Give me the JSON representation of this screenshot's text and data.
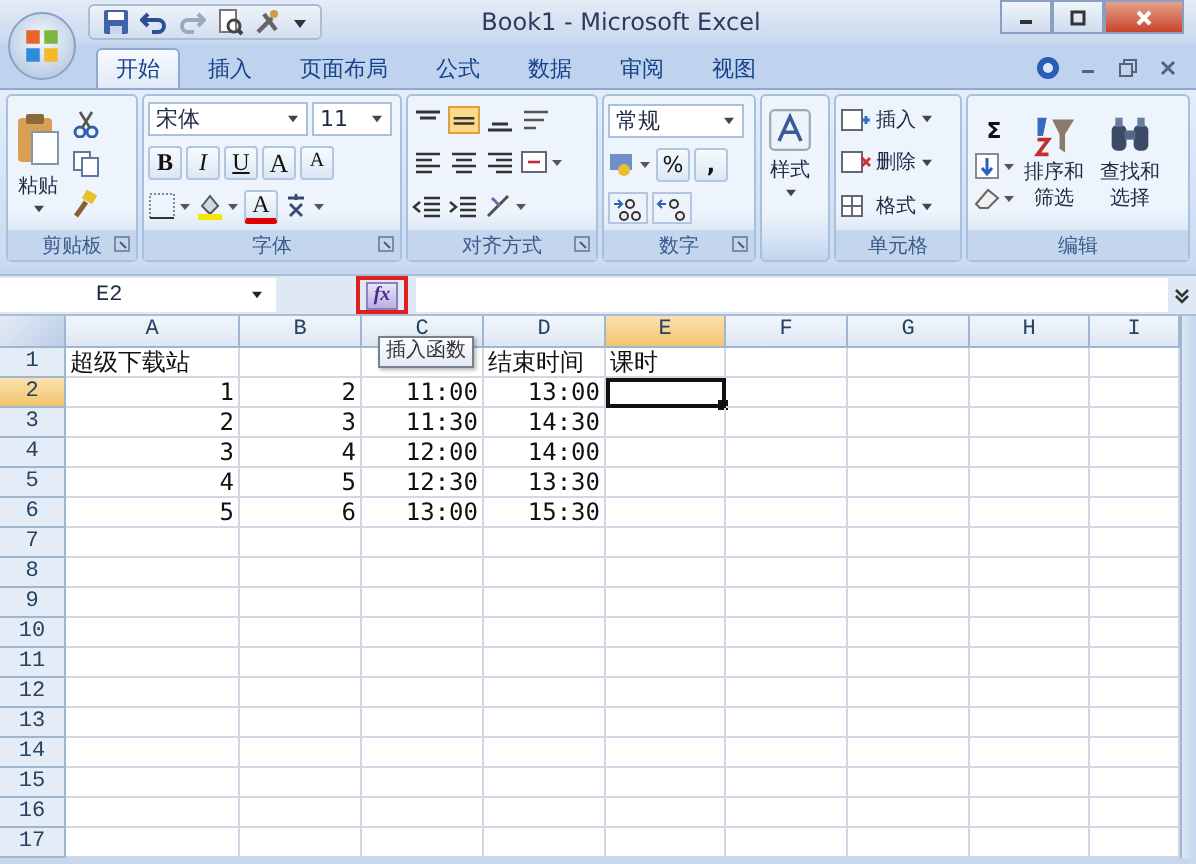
{
  "window": {
    "title": "Book1 - Microsoft Excel"
  },
  "tabs": [
    {
      "label": "开始",
      "selected": true
    },
    {
      "label": "插入",
      "selected": false
    },
    {
      "label": "页面布局",
      "selected": false
    },
    {
      "label": "公式",
      "selected": false
    },
    {
      "label": "数据",
      "selected": false
    },
    {
      "label": "审阅",
      "selected": false
    },
    {
      "label": "视图",
      "selected": false
    }
  ],
  "ribbon": {
    "clipboard": {
      "label": "剪贴板",
      "paste": "粘贴"
    },
    "font": {
      "label": "字体",
      "font_name": "宋体",
      "font_size": "11",
      "buttons": [
        {
          "label": "B",
          "kind": "bold"
        },
        {
          "label": "I",
          "kind": "italic"
        },
        {
          "label": "U",
          "kind": "underline"
        },
        {
          "label": "A",
          "kind": "grow"
        },
        {
          "label": "A",
          "kind": "shrink"
        }
      ],
      "font_color": "A"
    },
    "alignment": {
      "label": "对齐方式"
    },
    "number": {
      "label": "数字",
      "format": "常规",
      "percent": "%",
      "comma": ","
    },
    "styles": {
      "label": "样式"
    },
    "cells": {
      "label": "单元格",
      "items": [
        {
          "label": "插入",
          "kind": "insert"
        },
        {
          "label": "删除",
          "kind": "delete"
        },
        {
          "label": "格式",
          "kind": "format"
        }
      ]
    },
    "editing": {
      "label": "编辑",
      "sum": "Σ",
      "sort": "排序和筛选",
      "find": "查找和选择"
    }
  },
  "formula_bar": {
    "name_box": "E2",
    "fx": {
      "label": "fx",
      "highlighted": true
    }
  },
  "tooltip": "插入函数",
  "sheet": {
    "columns": [
      {
        "label": "A",
        "selected": false
      },
      {
        "label": "B",
        "selected": false
      },
      {
        "label": "C",
        "selected": false
      },
      {
        "label": "D",
        "selected": false
      },
      {
        "label": "E",
        "selected": true
      },
      {
        "label": "F",
        "selected": false
      },
      {
        "label": "G",
        "selected": false
      },
      {
        "label": "H",
        "selected": false
      },
      {
        "label": "I",
        "selected": false
      }
    ],
    "rows": [
      {
        "header": "1",
        "selected": false,
        "kind": "text",
        "cells": [
          "超级下载站",
          null,
          null,
          "结束时间",
          "课时"
        ]
      },
      {
        "header": "2",
        "selected": true,
        "kind": "number",
        "cells": [
          "1",
          "2",
          "11:00",
          "13:00"
        ]
      },
      {
        "header": "3",
        "selected": false,
        "kind": "number",
        "cells": [
          "2",
          "3",
          "11:30",
          "14:30"
        ]
      },
      {
        "header": "4",
        "selected": false,
        "kind": "number",
        "cells": [
          "3",
          "4",
          "12:00",
          "14:00"
        ]
      },
      {
        "header": "5",
        "selected": false,
        "kind": "number",
        "cells": [
          "4",
          "5",
          "12:30",
          "13:30"
        ]
      },
      {
        "header": "6",
        "selected": false,
        "kind": "number",
        "cells": [
          "5",
          "6",
          "13:00",
          "15:30"
        ]
      },
      {
        "header": "7",
        "selected": false,
        "kind": "empty"
      },
      {
        "header": "8",
        "selected": false,
        "kind": "empty"
      },
      {
        "header": "9",
        "selected": false,
        "kind": "empty"
      },
      {
        "header": "10",
        "selected": false,
        "kind": "empty"
      },
      {
        "header": "11",
        "selected": false,
        "kind": "empty"
      },
      {
        "header": "12",
        "selected": false,
        "kind": "empty"
      },
      {
        "header": "13",
        "selected": false,
        "kind": "empty"
      },
      {
        "header": "14",
        "selected": false,
        "kind": "empty"
      },
      {
        "header": "15",
        "selected": false,
        "kind": "empty"
      },
      {
        "header": "16",
        "selected": false,
        "kind": "empty"
      },
      {
        "header": "17",
        "selected": false,
        "kind": "empty"
      }
    ]
  }
}
